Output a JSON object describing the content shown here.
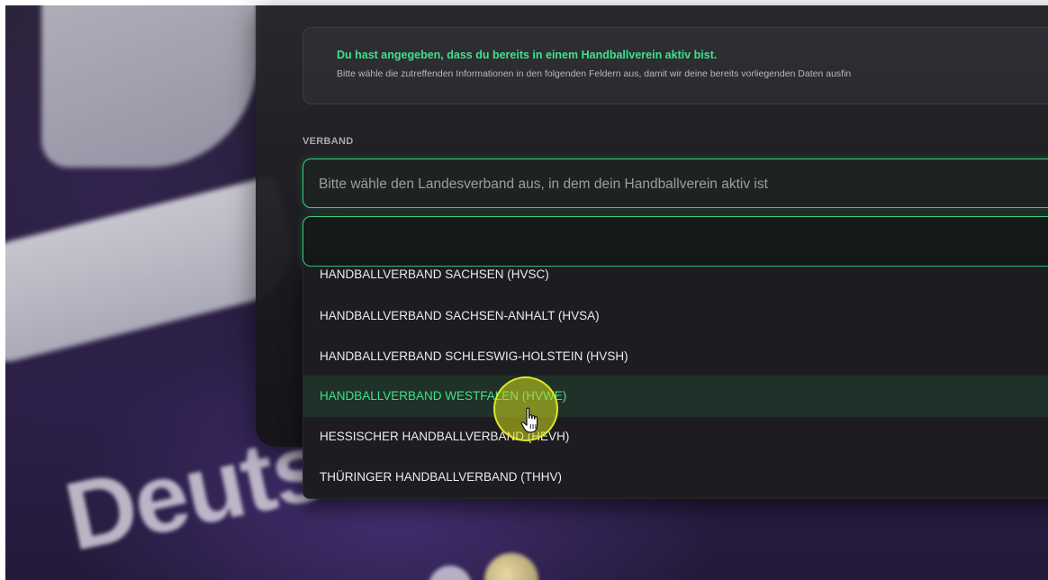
{
  "info": {
    "title": "Du hast angegeben, dass du bereits in einem Handballverein aktiv bist.",
    "text": "Bitte wähle die zutreffenden Informationen in den folgenden Feldern aus, damit wir deine bereits vorliegenden Daten ausfin"
  },
  "verband": {
    "label": "VERBAND",
    "placeholder": "Bitte wähle den Landesverband aus, in dem dein Handballverein aktiv ist",
    "search_value": "",
    "options": [
      "HANDBALLVERBAND SACHSEN (HVSC)",
      "HANDBALLVERBAND SACHSEN-ANHALT (HVSA)",
      "HANDBALLVERBAND SCHLESWIG-HOLSTEIN (HVSH)",
      "HANDBALLVERBAND WESTFALEN (HVWE)",
      "HESSISCHER HANDBALLVERBAND (HEVH)",
      "THÜRINGER HANDBALLVERBAND (THHV)"
    ],
    "highlighted_option": "HANDBALLVERBAND WESTFALEN (HVWE)"
  },
  "background": {
    "wordmark": "Deutscher"
  },
  "colors": {
    "accent": "#3fe28a",
    "highlight_row": "#1f3128",
    "click_indicator": "#cdd71e"
  },
  "icons": {
    "cursor": "hand-pointer-icon"
  }
}
